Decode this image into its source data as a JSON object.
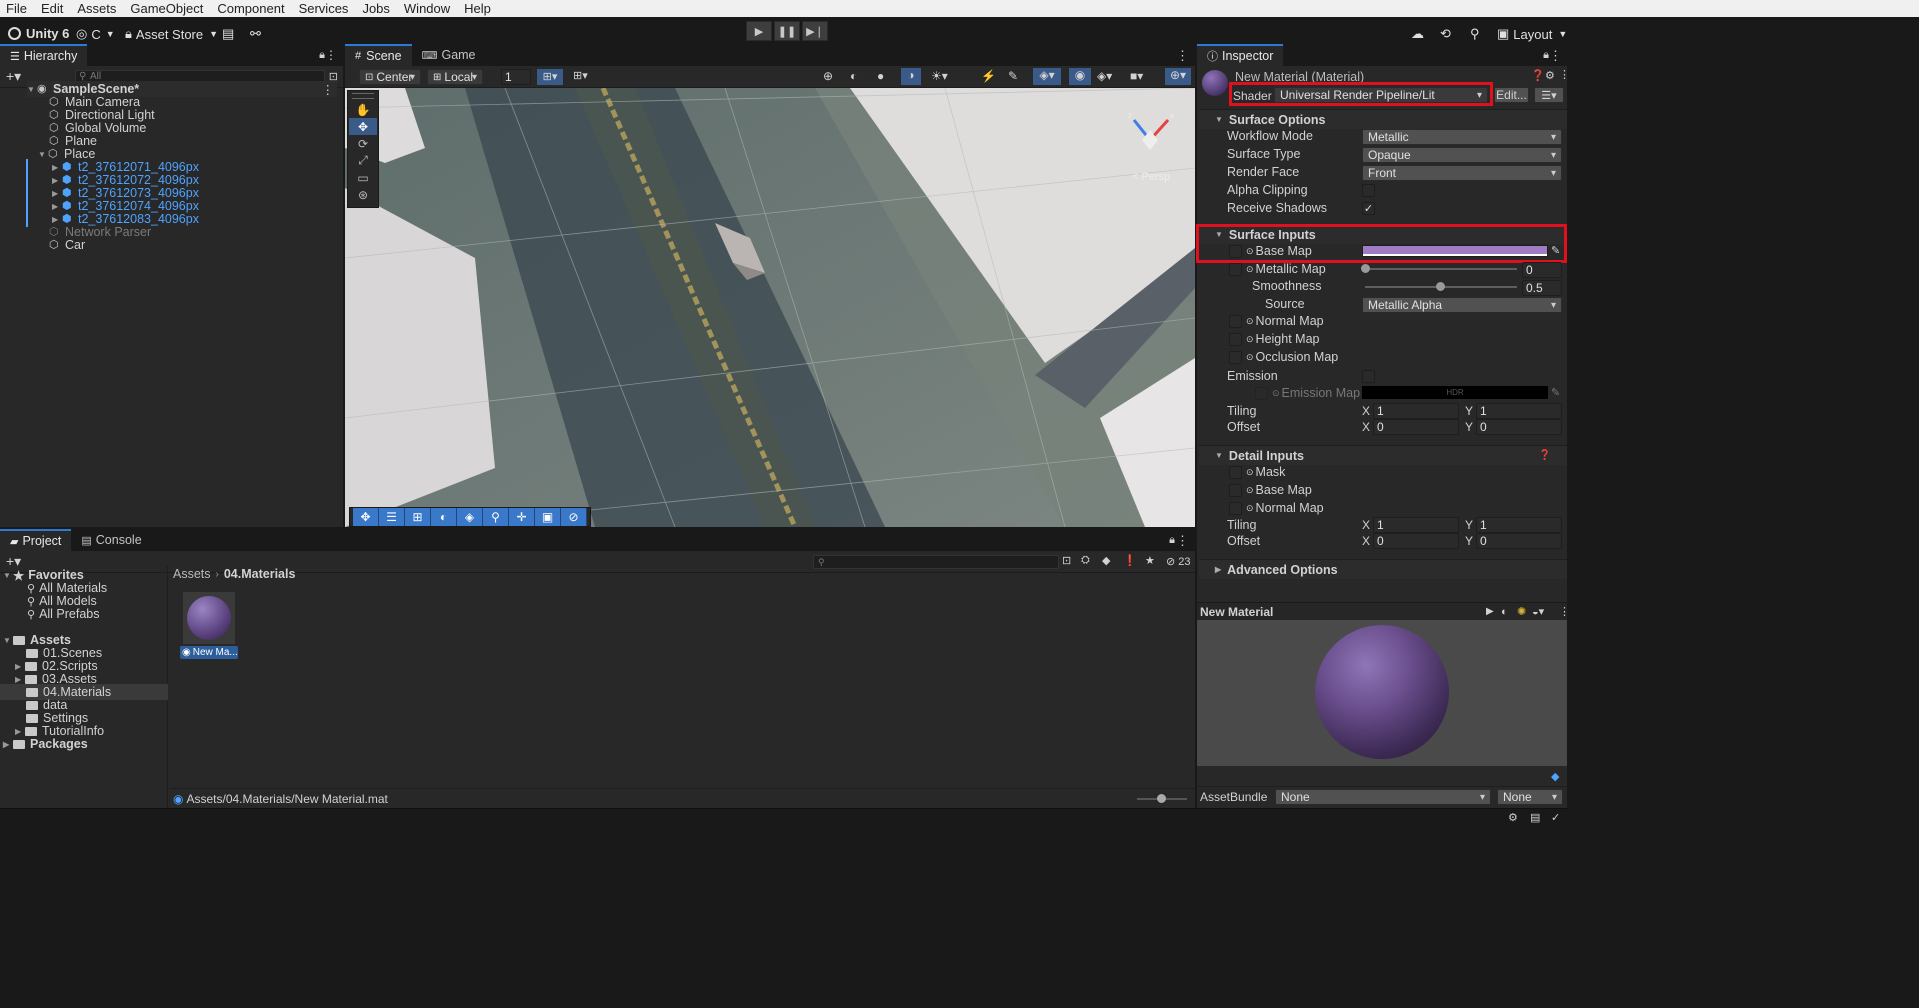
{
  "menu": [
    "File",
    "Edit",
    "Assets",
    "GameObject",
    "Component",
    "Services",
    "Jobs",
    "Window",
    "Help"
  ],
  "toolbar": {
    "unity_label": "Unity 6",
    "account_label": "C",
    "asset_store_label": "Asset Store",
    "layout_label": "Layout"
  },
  "hierarchy": {
    "tab": "Hierarchy",
    "search_placeholder": "All",
    "scene": "SampleScene*",
    "items": [
      "Main Camera",
      "Directional Light",
      "Global Volume",
      "Plane",
      "Place",
      "t2_37612071_4096px",
      "t2_37612072_4096px",
      "t2_37612073_4096px",
      "t2_37612074_4096px",
      "t2_37612083_4096px",
      "Network Parser",
      "Car"
    ]
  },
  "scene_view": {
    "tabs": [
      "Scene",
      "Game"
    ],
    "pivot_label": "Center",
    "space_label": "Local",
    "snap_value": "1",
    "persp_label": "< Persp",
    "gizmo_axes": [
      "x",
      "y",
      "z"
    ]
  },
  "project": {
    "tabs": [
      "Project",
      "Console"
    ],
    "favorites_label": "Favorites",
    "favorites": [
      "All Materials",
      "All Models",
      "All Prefabs"
    ],
    "assets_label": "Assets",
    "asset_folders": [
      "01.Scenes",
      "02.Scripts",
      "03.Assets",
      "04.Materials",
      "data",
      "Settings",
      "TutorialInfo"
    ],
    "packages_label": "Packages",
    "breadcrumb": [
      "Assets",
      "04.Materials"
    ],
    "file_label": "New Ma...",
    "path": "Assets/04.Materials/New Material.mat",
    "count": "23"
  },
  "inspector": {
    "tab": "Inspector",
    "material_name": "New Material (Material)",
    "shader_label": "Shader",
    "shader_value": "Universal Render Pipeline/Lit",
    "edit_label": "Edit...",
    "surface_options": {
      "title": "Surface Options",
      "workflow_label": "Workflow Mode",
      "workflow_value": "Metallic",
      "surface_type_label": "Surface Type",
      "surface_type_value": "Opaque",
      "render_face_label": "Render Face",
      "render_face_value": "Front",
      "alpha_clip_label": "Alpha Clipping",
      "receive_shadows_label": "Receive Shadows",
      "receive_shadows_checked": "✓"
    },
    "surface_inputs": {
      "title": "Surface Inputs",
      "base_map": "Base Map",
      "base_color": "#a07cc5",
      "metallic_map": "Metallic Map",
      "metallic_value": "0",
      "metallic_level": 0.0,
      "smoothness": "Smoothness",
      "smoothness_value": "0.5",
      "smoothness_level": 0.5,
      "source": "Source",
      "source_value": "Metallic Alpha",
      "normal_map": "Normal Map",
      "height_map": "Height Map",
      "occlusion_map": "Occlusion Map",
      "emission": "Emission",
      "emission_map": "Emission Map",
      "hdr": "HDR",
      "tiling": "Tiling",
      "offset": "Offset",
      "tiling_x": "1",
      "tiling_y": "1",
      "offset_x": "0",
      "offset_y": "0"
    },
    "detail_inputs": {
      "title": "Detail Inputs",
      "mask": "Mask",
      "base_map": "Base Map",
      "normal_map": "Normal Map",
      "tiling": "Tiling",
      "offset": "Offset",
      "tiling_x": "1",
      "tiling_y": "1",
      "offset_x": "0",
      "offset_y": "0"
    },
    "advanced_options": "Advanced Options",
    "preview_title": "New Material",
    "assetbundle_label": "AssetBundle",
    "assetbundle_value": "None",
    "assetbundle_variant": "None",
    "x_label": "X",
    "y_label": "Y"
  },
  "colors": {
    "accent": "#2d7ad6",
    "highlight": "#e0101c",
    "material": "#6b4f8e"
  }
}
